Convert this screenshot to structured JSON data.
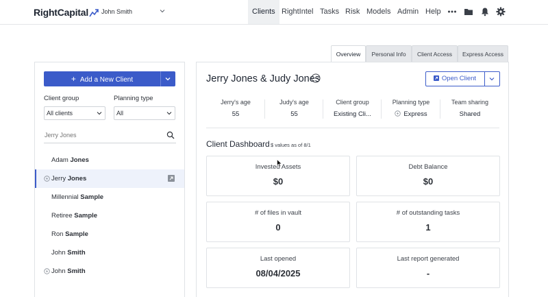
{
  "app": {
    "logo_text": "RightCapital",
    "user_name": "John Smith"
  },
  "nav": {
    "items": [
      {
        "label": "Clients",
        "active": true
      },
      {
        "label": "RightIntel"
      },
      {
        "label": "Tasks"
      },
      {
        "label": "Risk"
      },
      {
        "label": "Models"
      },
      {
        "label": "Admin"
      },
      {
        "label": "Help"
      }
    ],
    "icons": [
      "more-icon",
      "folder-icon",
      "bell-icon",
      "gear-icon"
    ]
  },
  "tabs": [
    {
      "label": "Overview",
      "active": true
    },
    {
      "label": "Personal Info"
    },
    {
      "label": "Client Access"
    },
    {
      "label": "Express Access"
    }
  ],
  "left": {
    "add_client_label": "Add a New Client",
    "client_group_label": "Client group",
    "client_group_value": "All clients",
    "planning_type_label": "Planning type",
    "planning_type_value": "All",
    "search_placeholder": "Jerry Jones",
    "clients": [
      {
        "first": "Adam",
        "last": "Jones",
        "icon": false,
        "selected": false
      },
      {
        "first": "Jerry",
        "last": "Jones",
        "icon": true,
        "selected": true
      },
      {
        "first": "Millennial",
        "last": "Sample",
        "icon": false,
        "selected": false
      },
      {
        "first": "Retiree",
        "last": "Sample",
        "icon": false,
        "selected": false
      },
      {
        "first": "Ron",
        "last": "Sample",
        "icon": false,
        "selected": false
      },
      {
        "first": "John",
        "last": "Smith",
        "icon": false,
        "selected": false
      },
      {
        "first": "John",
        "last": "Smith",
        "icon": true,
        "selected": false
      }
    ]
  },
  "main": {
    "client_title": "Jerry Jones & Judy Jones",
    "open_client_label": "Open Client",
    "info": [
      {
        "label": "Jerry's age",
        "value": "55"
      },
      {
        "label": "Judy's age",
        "value": "55"
      },
      {
        "label": "Client group",
        "value": "Existing Cli..."
      },
      {
        "label": "Planning type",
        "value": "Express"
      },
      {
        "label": "Team sharing",
        "value": "Shared"
      }
    ],
    "dashboard_title": "Client Dashboard",
    "dashboard_subtitle": "$ values as of 8/1",
    "cards": [
      {
        "title": "Invested Assets",
        "value": "$0"
      },
      {
        "title": "Debt Balance",
        "value": "$0"
      },
      {
        "title": "# of files in vault",
        "value": "0"
      },
      {
        "title": "# of outstanding tasks",
        "value": "1"
      },
      {
        "title": "Last opened",
        "value": "08/04/2025"
      },
      {
        "title": "Last report generated",
        "value": "-"
      }
    ]
  },
  "colors": {
    "accent": "#3b5bc9",
    "border": "#dfe2e6",
    "nav_active_bg": "#eef0f2"
  }
}
